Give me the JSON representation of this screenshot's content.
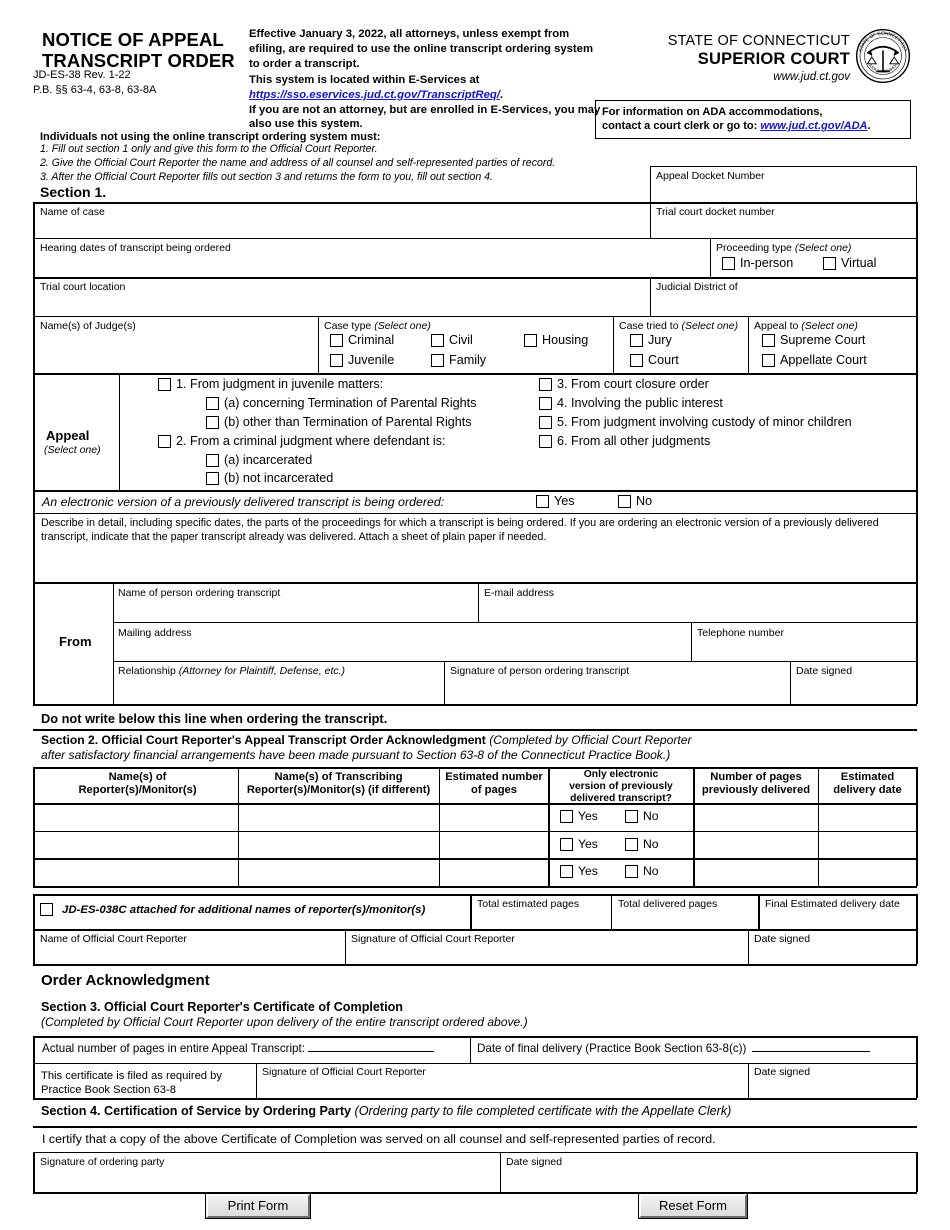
{
  "header": {
    "title_line1": "NOTICE OF APPEAL",
    "title_line2": "TRANSCRIPT ORDER",
    "form_number": "JD-ES-38    Rev. 1-22",
    "pb_refs": "P.B. §§ 63-4, 63-8, 63-8A",
    "effective_p1": "Effective January 3, 2022, all attorneys, unless exempt from efiling, are required to use the online transcript ordering system to order a transcript.",
    "effective_p2": "This system is located within E-Services at",
    "effective_url": "https://sso.eservices.jud.ct.gov/TranscriptReq/",
    "effective_p3": "If you are not an attorney, but are enrolled in E-Services, you may also use this system.",
    "state_line1": "STATE OF CONNECTICUT",
    "state_line2": "SUPERIOR COURT",
    "state_line3": "www.jud.ct.gov",
    "seal_text_top": "STATE OF CONNECTICUT",
    "seal_text_bottom": "JUDICIAL BRANCH",
    "ada_line1": "For information on ADA accommodations,",
    "ada_line2_pre": "contact a court clerk or go to: ",
    "ada_link": "www.jud.ct.gov/ADA",
    "ada_period": "."
  },
  "instructions": {
    "heading": "Individuals not using the online transcript ordering system must:",
    "items": [
      "1. Fill out section 1 only and give this form to the Official Court Reporter.",
      "2. Give the Official Court Reporter the name and address of all counsel and self-represented parties of record.",
      "3. After the Official Court Reporter fills out section 3 and returns the form to you, fill out section 4."
    ]
  },
  "section1": {
    "heading": "Section 1.",
    "appeal_docket_number": "Appeal Docket Number",
    "name_of_case": "Name of case",
    "trial_court_docket_number": "Trial court docket number",
    "hearing_dates": "Hearing dates of transcript being ordered",
    "proceeding_type_label": "Proceeding type",
    "select_one": "(Select one)",
    "proceeding_options": [
      "In-person",
      "Virtual"
    ],
    "trial_court_location": "Trial court location",
    "judicial_district_of": "Judicial District of",
    "names_of_judges": "Name(s) of Judge(s)",
    "case_type_label": "Case type",
    "case_type_options": [
      "Criminal",
      "Civil",
      "Juvenile",
      "Family",
      "Housing"
    ],
    "case_tried_to_label": "Case tried to",
    "case_tried_to_options": [
      "Jury",
      "Court"
    ],
    "appeal_to_label": "Appeal to",
    "appeal_to_options": [
      "Supreme Court",
      "Appellate Court"
    ]
  },
  "appeal_block": {
    "label": "Appeal",
    "select_one": "(Select one)",
    "left_items": [
      "1. From judgment in juvenile matters:",
      "(a) concerning Termination of Parental Rights",
      "(b) other than Termination of Parental Rights",
      "2. From a criminal judgment where defendant is:",
      "(a) incarcerated",
      "(b) not incarcerated"
    ],
    "right_items": [
      "3. From court closure order",
      "4. Involving the public interest",
      "5. From judgment involving custody of minor children",
      "6. From all other judgments"
    ]
  },
  "electronic_version": {
    "question": "An electronic version of a previously delivered transcript is being ordered:",
    "yes": "Yes",
    "no": "No"
  },
  "describe": {
    "text": "Describe in detail, including specific dates, the parts of the proceedings for which a transcript is being ordered. If you are ordering an electronic version of a previously delivered transcript, indicate that the paper transcript already was delivered. Attach a sheet of plain paper if needed."
  },
  "from_block": {
    "label": "From",
    "name_of_person": "Name of person ordering transcript",
    "email_address": "E-mail address",
    "mailing_address": "Mailing address",
    "telephone_number": "Telephone number",
    "relationship_pre": "Relationship ",
    "relationship_it": "(Attorney for Plaintiff, Defense, etc.)",
    "signature_of_person": "Signature of person ordering transcript",
    "date_signed": "Date signed"
  },
  "do_not_write": "Do not write below this line when ordering the transcript.",
  "section2": {
    "heading_bold": "Section 2. Official Court Reporter's Appeal Transcript Order Acknowledgment ",
    "heading_italic_1": "(Completed by Official Court Reporter",
    "heading_italic_2": "after satisfactory financial arrangements have been made pursuant to Section 63-8 of the Connecticut Practice Book.)",
    "columns": [
      "Name(s) of\nReporter(s)/Monitor(s)",
      "Name(s) of Transcribing\nReporter(s)/Monitor(s) (if different)",
      "Estimated number\nof pages",
      "Only electronic\nversion of previously\ndelivered transcript?",
      "Number of pages\npreviously delivered",
      "Estimated\ndelivery date"
    ],
    "col1_l1": "Name(s) of",
    "col1_l2": "Reporter(s)/Monitor(s)",
    "col2_l1": "Name(s) of Transcribing",
    "col2_l2": "Reporter(s)/Monitor(s) (if different)",
    "col3_l1": "Estimated number",
    "col3_l2": "of pages",
    "col4_l1": "Only electronic",
    "col4_l2": "version of previously",
    "col4_l3": "delivered transcript?",
    "col5_l1": "Number of pages",
    "col5_l2": "previously delivered",
    "col6_l1": "Estimated",
    "col6_l2": "delivery date",
    "row_yes": "Yes",
    "row_no": "No",
    "attached_text": "JD-ES-038C attached for additional names of reporter(s)/monitor(s)",
    "total_estimated_pages": "Total estimated pages",
    "total_delivered_pages": "Total delivered pages",
    "final_estimated_delivery_date": "Final Estimated delivery date",
    "name_of_official": "Name of Official Court Reporter",
    "signature_of_official": "Signature of Official Court Reporter",
    "date_signed": "Date signed"
  },
  "order_ack_heading": "Order Acknowledgment",
  "section3": {
    "heading": "Section 3. Official Court Reporter's Certificate of Completion",
    "subheading": "(Completed by Official Court Reporter upon delivery of the entire transcript ordered above.)",
    "actual_pages_label": "Actual number of pages in entire Appeal Transcript:",
    "date_final_delivery_label": "Date of final delivery (Practice Book Section 63-8(c))",
    "certificate_filed_l1": "This certificate is filed as required by",
    "certificate_filed_l2": "Practice Book Section 63-8",
    "signature_of_official": "Signature of Official Court Reporter",
    "date_signed": "Date signed"
  },
  "section4": {
    "heading_bold": "Section 4. Certification of Service by Ordering Party ",
    "heading_italic": "(Ordering party to file completed certificate with the Appellate Clerk)",
    "certify_text": "I certify that a copy of the above Certificate of Completion was served on all counsel and self-represented parties of record.",
    "signature_of_ordering_party": "Signature of ordering party",
    "date_signed": "Date signed"
  },
  "buttons": {
    "print": "Print Form",
    "reset": "Reset Form"
  }
}
